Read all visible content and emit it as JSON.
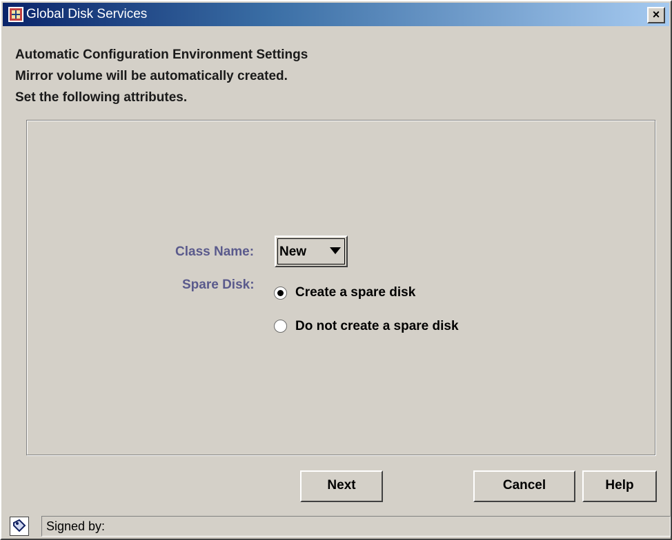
{
  "window": {
    "title": "Global Disk Services",
    "close_label": "×"
  },
  "header": {
    "line1": "Automatic Configuration Environment Settings",
    "line2": "Mirror volume will be automatically created.",
    "line3": "Set the following attributes."
  },
  "form": {
    "class_name_label": "Class Name:",
    "class_name_value": "New",
    "spare_disk_label": "Spare Disk:",
    "spare_options": [
      {
        "label": "Create a spare disk",
        "checked": true
      },
      {
        "label": "Do not create a spare disk",
        "checked": false
      }
    ]
  },
  "buttons": {
    "next": "Next",
    "cancel": "Cancel",
    "help": "Help"
  },
  "status": {
    "text": "Signed by:"
  }
}
